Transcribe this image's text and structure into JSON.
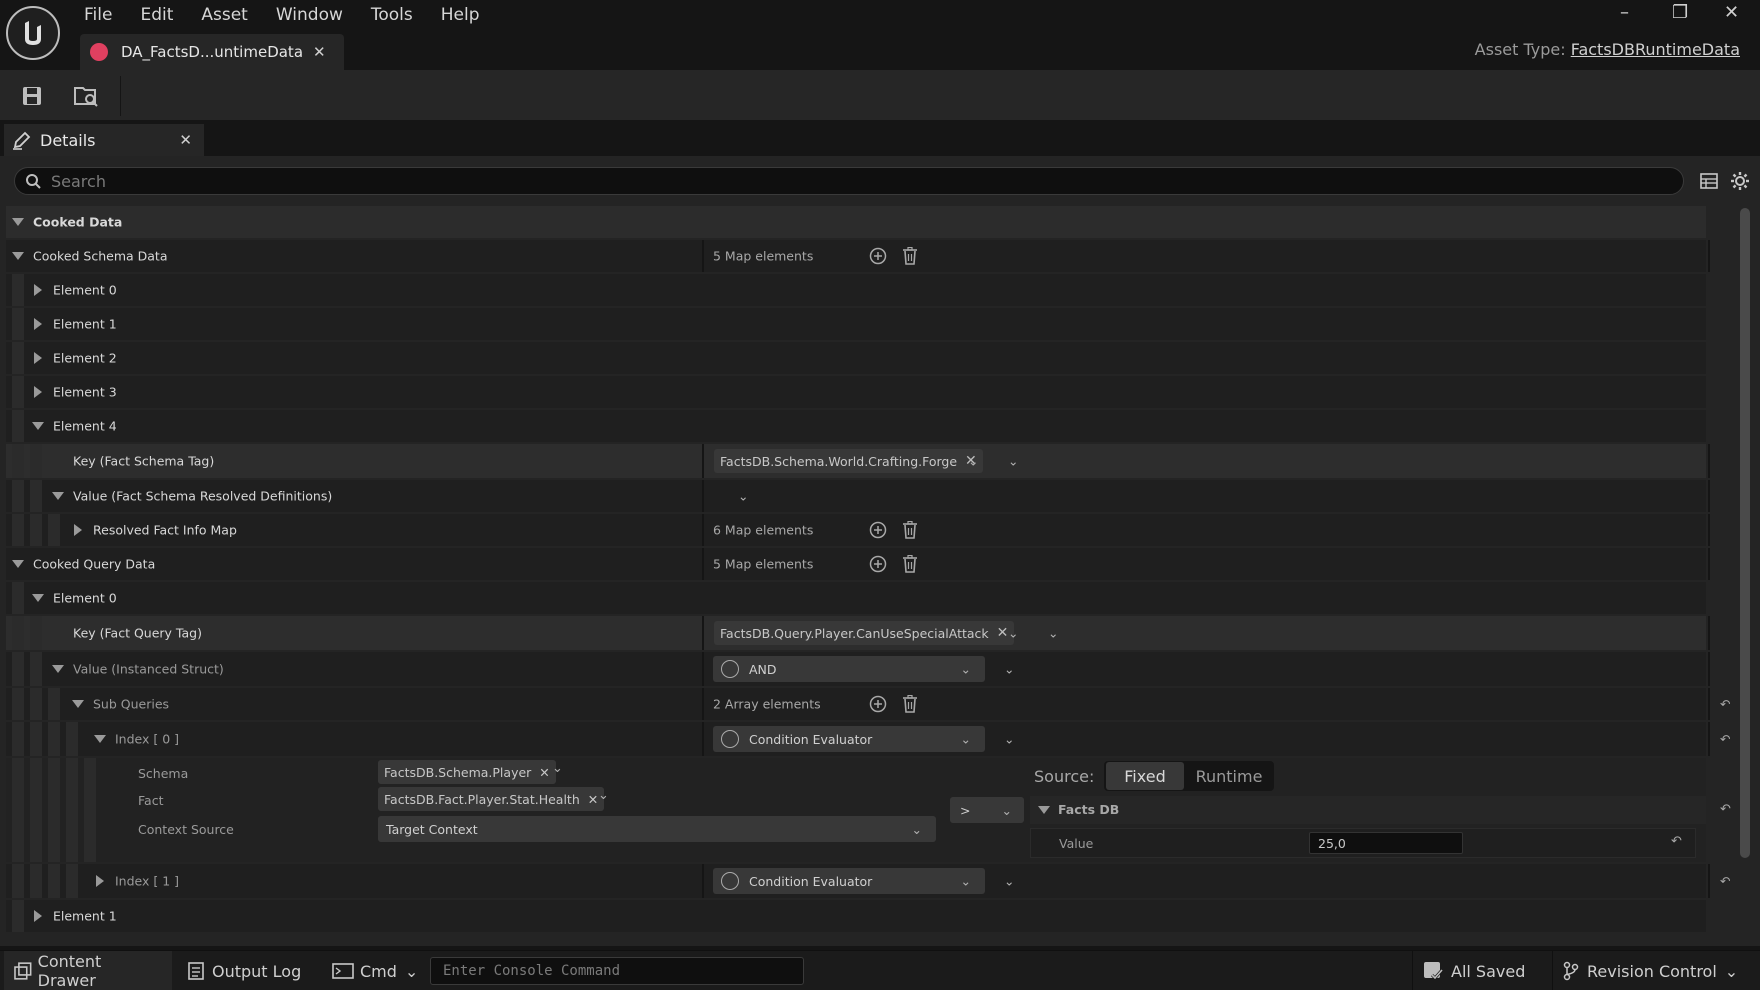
{
  "menu": [
    "File",
    "Edit",
    "Asset",
    "Window",
    "Tools",
    "Help"
  ],
  "document_tab": {
    "label": "DA_FactsD...untimeData",
    "close": "✕"
  },
  "asset_type": {
    "prefix": "Asset Type:",
    "value": "FactsDBRuntimeData"
  },
  "window_controls": {
    "minimize": "–",
    "restore": "❐",
    "close": "✕"
  },
  "details_tab": {
    "label": "Details",
    "close": "✕"
  },
  "search": {
    "placeholder": "Search"
  },
  "rows": {
    "cooked_data": "Cooked Data",
    "cooked_schema_data": "Cooked Schema Data",
    "schema_map_count": "5 Map elements",
    "element0": "Element 0",
    "element1": "Element 1",
    "element2": "Element 2",
    "element3": "Element 3",
    "element4": "Element 4",
    "key_schema_tag": "Key (Fact Schema Tag)",
    "schema_tag_value": "FactsDB.Schema.World.Crafting.Forge",
    "value_schema_resolved": "Value (Fact Schema Resolved Definitions)",
    "resolved_fact_info_map": "Resolved Fact Info Map",
    "resolved_map_count": "6 Map elements",
    "cooked_query_data": "Cooked Query Data",
    "query_map_count": "5 Map elements",
    "q_element0": "Element 0",
    "key_query_tag": "Key (Fact Query Tag)",
    "query_tag_value": "FactsDB.Query.Player.CanUseSpecialAttack",
    "value_instanced_struct": "Value (Instanced Struct)",
    "and_combo": "AND",
    "sub_queries": "Sub Queries",
    "sub_queries_count": "2 Array elements",
    "index0": "Index [ 0 ]",
    "condition_evaluator": "Condition Evaluator",
    "schema_label": "Schema",
    "schema_value": "FactsDB.Schema.Player",
    "fact_label": "Fact",
    "fact_value": "FactsDB.Fact.Player.Stat.Health",
    "context_source_label": "Context Source",
    "context_source_value": "Target Context",
    "operator": ">",
    "source_label": "Source:",
    "source_fixed": "Fixed",
    "source_runtime": "Runtime",
    "facts_db": "Facts DB",
    "value_label": "Value",
    "value_value": "25,0",
    "index1": "Index [ 1 ]",
    "condition_evaluator_1": "Condition Evaluator",
    "q_element1": "Element 1"
  },
  "statusbar": {
    "content_drawer": "Content Drawer",
    "output_log": "Output Log",
    "cmd": "Cmd",
    "console_placeholder": "Enter Console Command",
    "all_saved": "All Saved",
    "revision_control": "Revision Control"
  }
}
